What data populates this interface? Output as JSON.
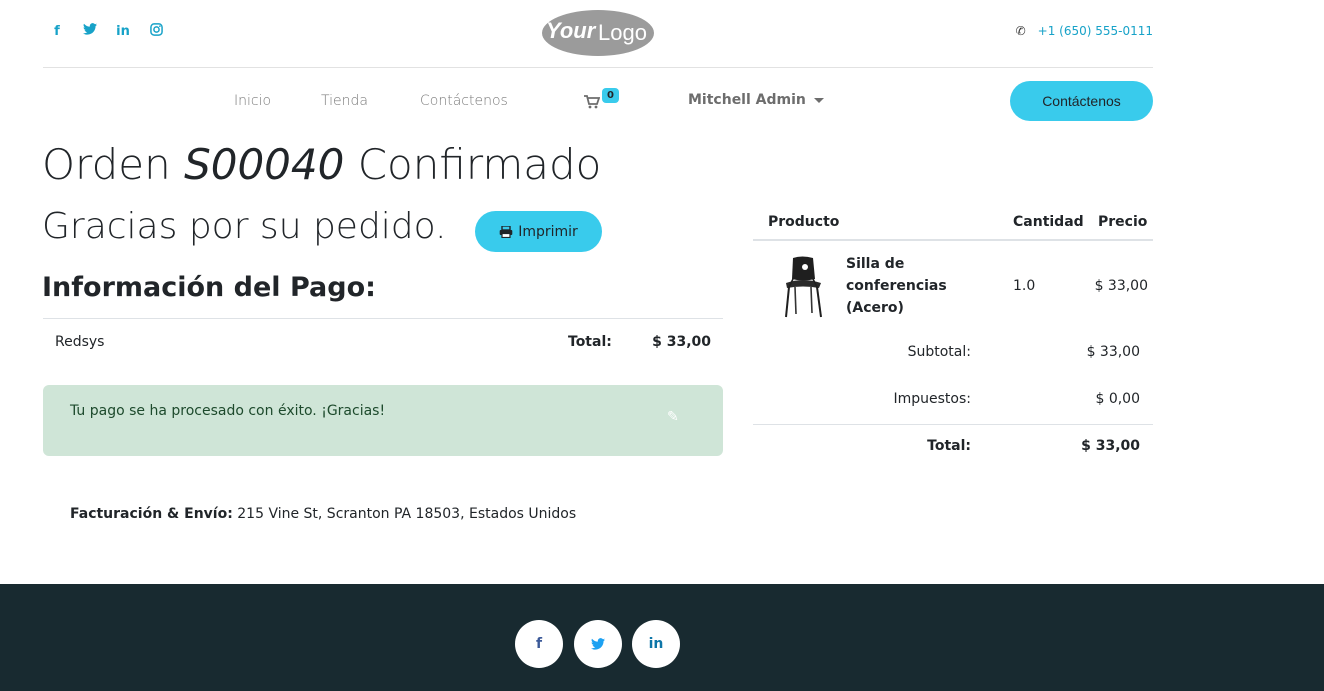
{
  "header": {
    "social": [
      "facebook-icon",
      "twitter-icon",
      "linkedin-icon",
      "instagram-icon"
    ],
    "logo_text_bold": "Your",
    "logo_text_light": "Logo",
    "phone": "+1 (650) 555-0111"
  },
  "nav": {
    "items": [
      "Inicio",
      "Tienda",
      "Contáctenos"
    ],
    "cart_count": "0",
    "user": "Mitchell Admin",
    "cta": "Contáctenos"
  },
  "order": {
    "title_prefix": "Orden",
    "order_number": "S00040",
    "title_suffix": "Confirmado",
    "thanks": "Gracias por su pedido.",
    "print_label": "Imprimir",
    "payment_heading": "Información del Pago:",
    "payment_method": "Redsys",
    "payment_total_label": "Total:",
    "payment_total": "$ 33,00",
    "success_msg": "Tu pago se ha procesado con éxito. ¡Gracias!",
    "address_label": "Facturación & Envío:",
    "address": "215 Vine St, Scranton PA 18503, Estados Unidos"
  },
  "cart_table": {
    "headers": [
      "Producto",
      "Cantidad",
      "Precio"
    ],
    "rows": [
      {
        "name": "Silla de conferencias (Acero)",
        "qty": "1.0",
        "price": "$ 33,00"
      }
    ],
    "subtotal_label": "Subtotal:",
    "subtotal": "$ 33,00",
    "tax_label": "Impuestos:",
    "tax": "$ 0,00",
    "total_label": "Total:",
    "total": "$ 33,00"
  },
  "footer": {
    "social": [
      "facebook-icon",
      "twitter-icon",
      "linkedin-icon"
    ]
  },
  "colors": {
    "accent": "#39cbec",
    "link": "#17a2c8",
    "alert_bg": "#cfe5d7",
    "footer_bg": "#182a30"
  }
}
